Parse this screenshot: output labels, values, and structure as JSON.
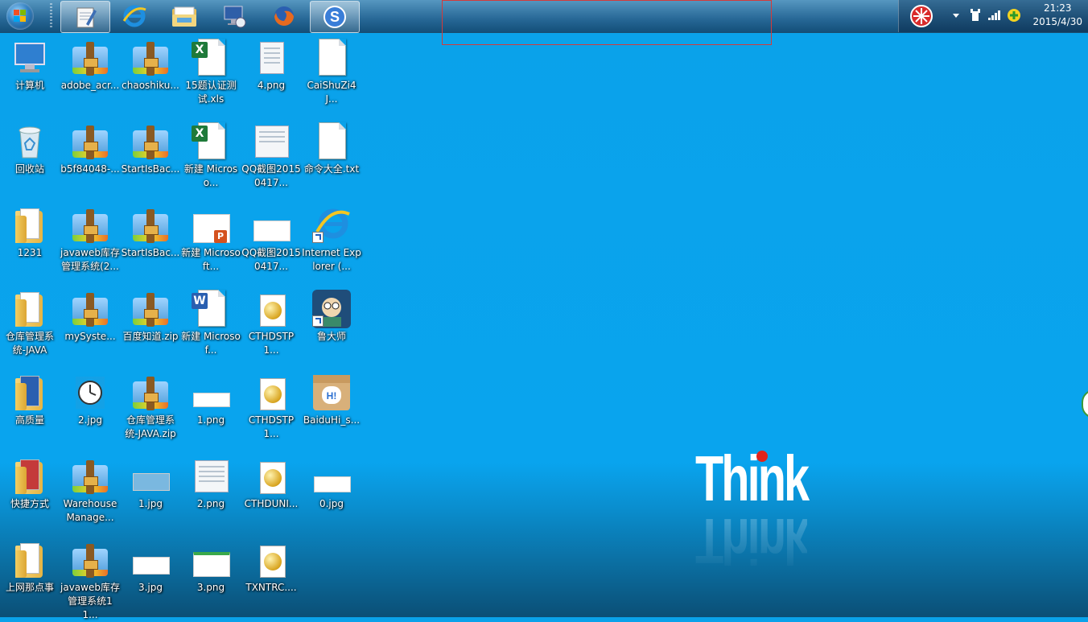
{
  "taskbar": {
    "apps": [
      {
        "name": "notepad",
        "active": true
      },
      {
        "name": "internet-explorer",
        "active": false
      },
      {
        "name": "file-explorer",
        "active": false
      },
      {
        "name": "network-monitor",
        "active": false
      },
      {
        "name": "firefox",
        "active": false
      },
      {
        "name": "sogou-input",
        "active": true
      }
    ],
    "clock_time": "21:23",
    "clock_date": "2015/4/30"
  },
  "wallpaper": {
    "brand_text": "Think"
  },
  "desktop": {
    "icons": [
      {
        "label": "计算机",
        "type": "computer"
      },
      {
        "label": "回收站",
        "type": "recycle"
      },
      {
        "label": "1231",
        "type": "folder"
      },
      {
        "label": "仓库管理系统-JAVA",
        "type": "folder"
      },
      {
        "label": "高质量",
        "type": "folder"
      },
      {
        "label": "快捷方式",
        "type": "folder"
      },
      {
        "label": "上网那点事",
        "type": "folder"
      },
      {
        "label": "adobe_acr...",
        "type": "zip"
      },
      {
        "label": "b5f84048-...",
        "type": "zip"
      },
      {
        "label": "javaweb库存管理系统(2...",
        "type": "zip"
      },
      {
        "label": "mySyste...",
        "type": "zip"
      },
      {
        "label": "2.jpg",
        "type": "clock"
      },
      {
        "label": "Warehouse Manage...",
        "type": "zip"
      },
      {
        "label": "javaweb库存管理系统11...",
        "type": "zip"
      },
      {
        "label": "chaoshiku...",
        "type": "zip"
      },
      {
        "label": "StartIsBac...",
        "type": "zip"
      },
      {
        "label": "StartIsBac...",
        "type": "zip"
      },
      {
        "label": "百度知道.zip",
        "type": "zip"
      },
      {
        "label": "仓库管理系统-JAVA.zip",
        "type": "zip"
      },
      {
        "label": "1.jpg",
        "type": "thumb"
      },
      {
        "label": "3.jpg",
        "type": "thumb"
      },
      {
        "label": "15题认证测试.xls",
        "type": "excel"
      },
      {
        "label": "新建 Microso...",
        "type": "excel"
      },
      {
        "label": "新建 Microsoft...",
        "type": "ppt"
      },
      {
        "label": "新建 Microsof...",
        "type": "word"
      },
      {
        "label": "1.png",
        "type": "thumb"
      },
      {
        "label": "2.png",
        "type": "shot"
      },
      {
        "label": "3.png",
        "type": "thumb"
      },
      {
        "label": "4.png",
        "type": "shot"
      },
      {
        "label": "QQ截图20150417...",
        "type": "shot"
      },
      {
        "label": "QQ截图20150417...",
        "type": "thumb"
      },
      {
        "label": "CTHDSTP1...",
        "type": "cthd"
      },
      {
        "label": "CTHDSTP1...",
        "type": "cthd"
      },
      {
        "label": "CTHDUNI...",
        "type": "cthd"
      },
      {
        "label": "TXNTRC....",
        "type": "cthd"
      },
      {
        "label": "CaiShuZi4J...",
        "type": "txt"
      },
      {
        "label": "命令大全.txt",
        "type": "txt"
      },
      {
        "label": "Internet Explorer (...",
        "type": "ie"
      },
      {
        "label": "鲁大师",
        "type": "ludashi"
      },
      {
        "label": "BaiduHi_s...",
        "type": "baiduhi"
      },
      {
        "label": "0.jpg",
        "type": "thumb"
      }
    ]
  }
}
